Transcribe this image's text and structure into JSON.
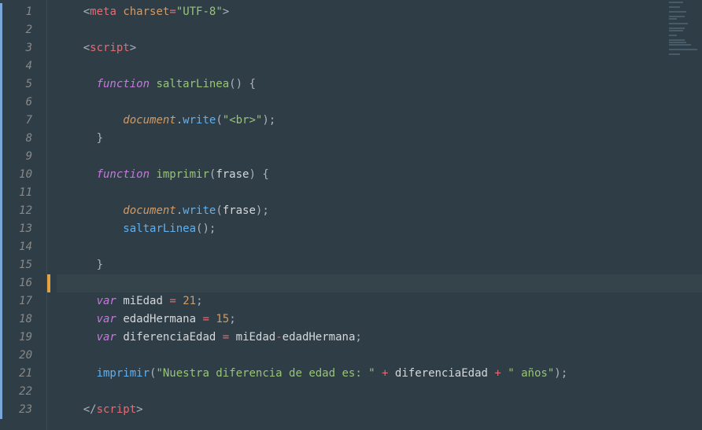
{
  "editor": {
    "active_line": 16,
    "line_numbers": [
      "1",
      "2",
      "3",
      "4",
      "5",
      "6",
      "7",
      "8",
      "9",
      "10",
      "11",
      "12",
      "13",
      "14",
      "15",
      "16",
      "17",
      "18",
      "19",
      "20",
      "21",
      "22",
      "23"
    ],
    "lines": [
      {
        "indent": "    ",
        "tokens": [
          {
            "t": "<",
            "c": "c-punct"
          },
          {
            "t": "meta",
            "c": "c-tag"
          },
          {
            "t": " ",
            "c": "c-plain"
          },
          {
            "t": "charset",
            "c": "c-attr"
          },
          {
            "t": "=",
            "c": "c-oper"
          },
          {
            "t": "\"UTF-8\"",
            "c": "c-str"
          },
          {
            "t": ">",
            "c": "c-punct"
          }
        ]
      },
      {
        "indent": "",
        "tokens": []
      },
      {
        "indent": "    ",
        "tokens": [
          {
            "t": "<",
            "c": "c-punct"
          },
          {
            "t": "script",
            "c": "c-tag"
          },
          {
            "t": ">",
            "c": "c-punct"
          }
        ]
      },
      {
        "indent": "",
        "tokens": []
      },
      {
        "indent": "      ",
        "tokens": [
          {
            "t": "function",
            "c": "c-kw"
          },
          {
            "t": " ",
            "c": "c-plain"
          },
          {
            "t": "saltarLinea",
            "c": "c-funcname"
          },
          {
            "t": "()",
            "c": "c-punct"
          },
          {
            "t": " ",
            "c": "c-plain"
          },
          {
            "t": "{",
            "c": "c-punct"
          }
        ]
      },
      {
        "indent": "",
        "tokens": []
      },
      {
        "indent": "          ",
        "tokens": [
          {
            "t": "document",
            "c": "c-ident"
          },
          {
            "t": ".",
            "c": "c-punct"
          },
          {
            "t": "write",
            "c": "c-method"
          },
          {
            "t": "(",
            "c": "c-punct"
          },
          {
            "t": "\"<br>\"",
            "c": "c-str"
          },
          {
            "t": ")",
            "c": "c-punct"
          },
          {
            "t": ";",
            "c": "c-punct"
          }
        ]
      },
      {
        "indent": "      ",
        "tokens": [
          {
            "t": "}",
            "c": "c-punct"
          }
        ]
      },
      {
        "indent": "",
        "tokens": []
      },
      {
        "indent": "      ",
        "tokens": [
          {
            "t": "function",
            "c": "c-kw"
          },
          {
            "t": " ",
            "c": "c-plain"
          },
          {
            "t": "imprimir",
            "c": "c-funcname"
          },
          {
            "t": "(",
            "c": "c-punct"
          },
          {
            "t": "frase",
            "c": "c-param"
          },
          {
            "t": ")",
            "c": "c-punct"
          },
          {
            "t": " ",
            "c": "c-plain"
          },
          {
            "t": "{",
            "c": "c-punct"
          }
        ]
      },
      {
        "indent": "",
        "tokens": []
      },
      {
        "indent": "          ",
        "tokens": [
          {
            "t": "document",
            "c": "c-ident"
          },
          {
            "t": ".",
            "c": "c-punct"
          },
          {
            "t": "write",
            "c": "c-method"
          },
          {
            "t": "(",
            "c": "c-punct"
          },
          {
            "t": "frase",
            "c": "c-param"
          },
          {
            "t": ")",
            "c": "c-punct"
          },
          {
            "t": ";",
            "c": "c-punct"
          }
        ]
      },
      {
        "indent": "          ",
        "tokens": [
          {
            "t": "saltarLinea",
            "c": "c-func"
          },
          {
            "t": "()",
            "c": "c-punct"
          },
          {
            "t": ";",
            "c": "c-punct"
          }
        ]
      },
      {
        "indent": "",
        "tokens": []
      },
      {
        "indent": "      ",
        "tokens": [
          {
            "t": "}",
            "c": "c-punct"
          }
        ]
      },
      {
        "indent": "",
        "tokens": []
      },
      {
        "indent": "      ",
        "tokens": [
          {
            "t": "var",
            "c": "c-kw"
          },
          {
            "t": " ",
            "c": "c-plain"
          },
          {
            "t": "miEdad",
            "c": "c-plain"
          },
          {
            "t": " ",
            "c": "c-plain"
          },
          {
            "t": "=",
            "c": "c-oper"
          },
          {
            "t": " ",
            "c": "c-plain"
          },
          {
            "t": "21",
            "c": "c-num"
          },
          {
            "t": ";",
            "c": "c-punct"
          }
        ]
      },
      {
        "indent": "      ",
        "tokens": [
          {
            "t": "var",
            "c": "c-kw"
          },
          {
            "t": " ",
            "c": "c-plain"
          },
          {
            "t": "edadHermana",
            "c": "c-plain"
          },
          {
            "t": " ",
            "c": "c-plain"
          },
          {
            "t": "=",
            "c": "c-oper"
          },
          {
            "t": " ",
            "c": "c-plain"
          },
          {
            "t": "15",
            "c": "c-num"
          },
          {
            "t": ";",
            "c": "c-punct"
          }
        ]
      },
      {
        "indent": "      ",
        "tokens": [
          {
            "t": "var",
            "c": "c-kw"
          },
          {
            "t": " ",
            "c": "c-plain"
          },
          {
            "t": "diferenciaEdad",
            "c": "c-plain"
          },
          {
            "t": " ",
            "c": "c-plain"
          },
          {
            "t": "=",
            "c": "c-oper"
          },
          {
            "t": " ",
            "c": "c-plain"
          },
          {
            "t": "miEdad",
            "c": "c-plain"
          },
          {
            "t": "-",
            "c": "c-oper"
          },
          {
            "t": "edadHermana",
            "c": "c-plain"
          },
          {
            "t": ";",
            "c": "c-punct"
          }
        ]
      },
      {
        "indent": "",
        "tokens": []
      },
      {
        "indent": "      ",
        "tokens": [
          {
            "t": "imprimir",
            "c": "c-func"
          },
          {
            "t": "(",
            "c": "c-punct"
          },
          {
            "t": "\"Nuestra diferencia de edad es: \"",
            "c": "c-str"
          },
          {
            "t": " ",
            "c": "c-plain"
          },
          {
            "t": "+",
            "c": "c-oper"
          },
          {
            "t": " ",
            "c": "c-plain"
          },
          {
            "t": "diferenciaEdad",
            "c": "c-plain"
          },
          {
            "t": " ",
            "c": "c-plain"
          },
          {
            "t": "+",
            "c": "c-oper"
          },
          {
            "t": " ",
            "c": "c-plain"
          },
          {
            "t": "\" años\"",
            "c": "c-str"
          },
          {
            "t": ")",
            "c": "c-punct"
          },
          {
            "t": ";",
            "c": "c-punct"
          }
        ]
      },
      {
        "indent": "",
        "tokens": []
      },
      {
        "indent": "    ",
        "tokens": [
          {
            "t": "</",
            "c": "c-punct"
          },
          {
            "t": "script",
            "c": "c-tag"
          },
          {
            "t": ">",
            "c": "c-punct"
          }
        ]
      }
    ]
  },
  "minimap": {
    "widths": [
      18,
      0,
      14,
      0,
      22,
      0,
      20,
      10,
      0,
      24,
      0,
      20,
      18,
      0,
      10,
      0,
      20,
      22,
      28,
      0,
      36,
      0,
      14
    ]
  }
}
